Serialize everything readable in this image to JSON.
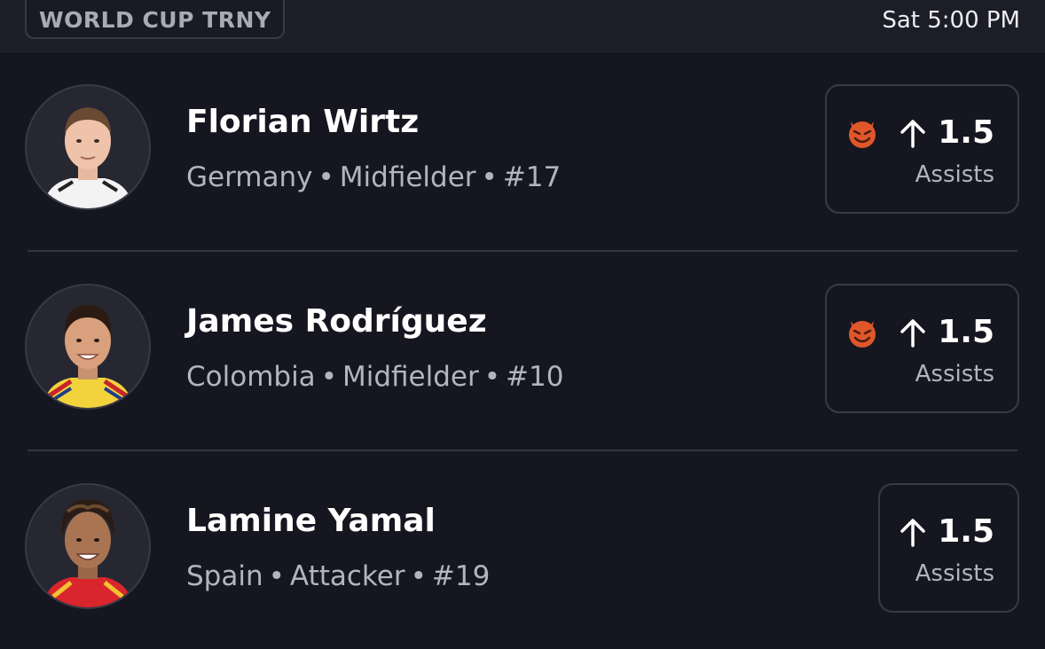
{
  "header": {
    "tournament": "WORLD CUP TRNY",
    "game_time": "Sat 5:00 PM"
  },
  "players": [
    {
      "name": "Florian Wirtz",
      "country": "Germany",
      "position": "Midfielder",
      "number": "#17",
      "line": "1.5",
      "stat": "Assists",
      "direction": "up",
      "demon_badge": true,
      "jersey_color": "#f3f3f3"
    },
    {
      "name": "James Rodríguez",
      "country": "Colombia",
      "position": "Midfielder",
      "number": "#10",
      "line": "1.5",
      "stat": "Assists",
      "direction": "up",
      "demon_badge": true,
      "jersey_color": "#f2d33c"
    },
    {
      "name": "Lamine Yamal",
      "country": "Spain",
      "position": "Attacker",
      "number": "#19",
      "line": "1.5",
      "stat": "Assists",
      "direction": "up",
      "demon_badge": false,
      "jersey_color": "#d8262c"
    }
  ],
  "separator": "•",
  "icons": {
    "badge": "smiling-devil-icon",
    "direction": "arrow-up-icon"
  }
}
